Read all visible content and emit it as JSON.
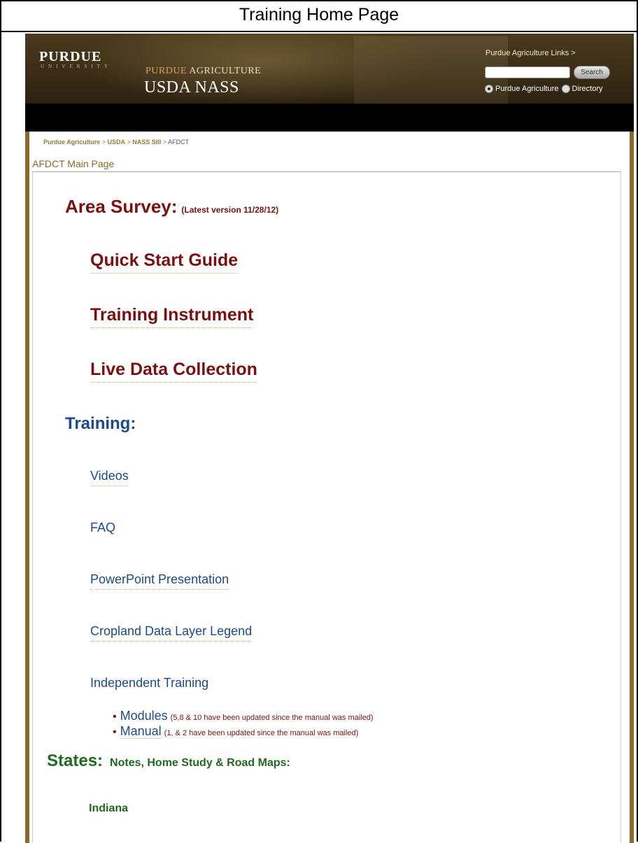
{
  "caption": "Training Home Page",
  "header": {
    "logo_name": "PURDUE",
    "logo_sub": "UNIVERSITY",
    "ag_prefix": "PURDUE",
    "ag_suffix": "AGRICULTURE",
    "site_title": "USDA NASS",
    "ag_links": "Purdue Agriculture Links >",
    "search_placeholder": "",
    "search_button": "Search",
    "radio_options": [
      "Purdue Agriculture",
      "Directory"
    ]
  },
  "breadcrumb": {
    "items": [
      "Purdue Agriculture",
      "USDA",
      "NASS SIII"
    ],
    "separator": ">",
    "current": "AFDCT"
  },
  "page_title": "AFDCT Main Page",
  "area_survey": {
    "heading": "Area Survey:",
    "version_note": "(Latest version 11/28/12)",
    "links": [
      "Quick Start Guide",
      "Training Instrument",
      "Live Data Collection"
    ]
  },
  "training": {
    "heading": "Training:",
    "links": [
      "Videos",
      "FAQ",
      "PowerPoint Presentation",
      "Cropland Data Layer Legend"
    ],
    "independent": "Independent Training",
    "sub_items": [
      {
        "label": "Modules",
        "note": "(5,8 & 10 have been updated since the manual was mailed)"
      },
      {
        "label": "Manual",
        "note": "(1, & 2 have been updated since the manual was mailed)"
      }
    ]
  },
  "states": {
    "heading": "States:",
    "subheading": "Notes, Home Study & Road Maps:",
    "first_state": "Indiana"
  }
}
